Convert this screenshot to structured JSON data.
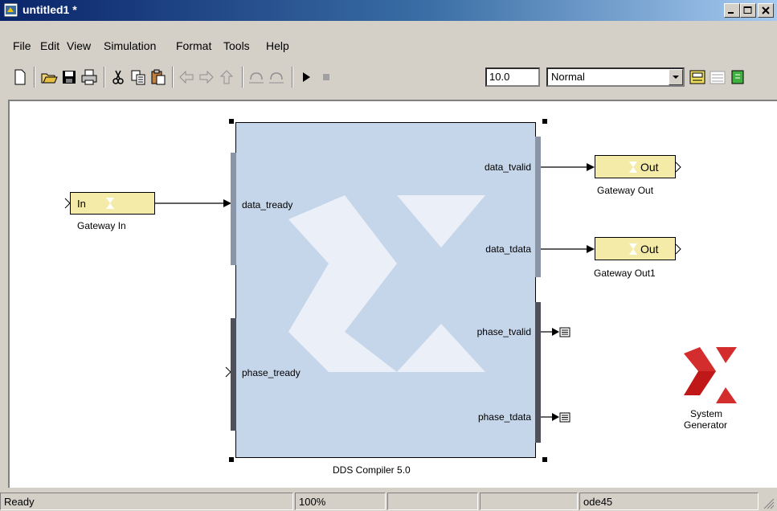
{
  "window": {
    "title": "untitled1 *"
  },
  "menu": [
    "File",
    "Edit",
    "View",
    "Simulation",
    "Format",
    "Tools",
    "Help"
  ],
  "toolbar": {
    "stop_time": "10.0",
    "sim_mode": "Normal"
  },
  "blocks": {
    "gateway_in": {
      "label": "Gateway In",
      "text": "In"
    },
    "gateway_out": {
      "label": "Gateway Out",
      "text": "Out"
    },
    "gateway_out1": {
      "label": "Gateway Out1",
      "text": "Out"
    },
    "dds": {
      "label": "DDS Compiler 5.0",
      "inputs": [
        "data_tready",
        "phase_tready"
      ],
      "outputs": [
        "data_tvalid",
        "data_tdata",
        "phase_tvalid",
        "phase_tdata"
      ]
    },
    "sysgen": {
      "line1": "System",
      "line2": "Generator"
    }
  },
  "status": {
    "state": "Ready",
    "zoom": "100%",
    "solver": "ode45"
  },
  "colors": {
    "block_fill": "#c5d5ea",
    "gateway_fill": "#f5eba8",
    "title_start": "#0a246a",
    "xilinx_red": "#d42d2d"
  }
}
